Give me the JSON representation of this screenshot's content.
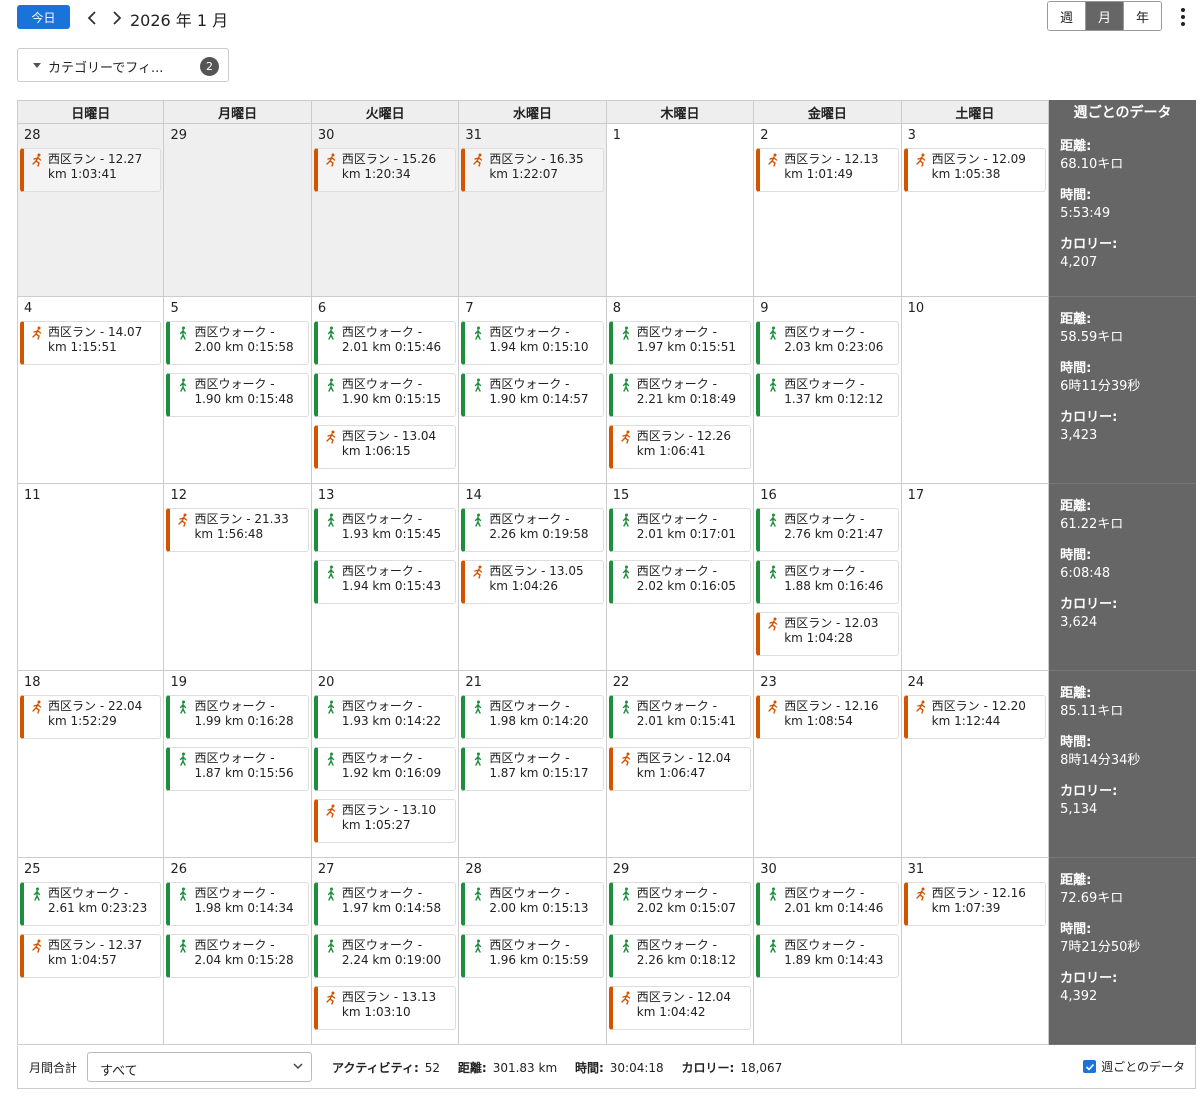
{
  "toolbar": {
    "today_label": "今日",
    "month_title": "2026 年 1 月",
    "views": [
      "週",
      "月",
      "年"
    ],
    "active_view": "月"
  },
  "filter": {
    "label": "カテゴリーでフィ...",
    "count": "2"
  },
  "weekdays": [
    "日曜日",
    "月曜日",
    "火曜日",
    "水曜日",
    "木曜日",
    "金曜日",
    "土曜日"
  ],
  "weekly_header": "週ごとのデータ",
  "weekly_labels": {
    "distance": "距離:",
    "time": "時間:",
    "calories": "カロリー:"
  },
  "colors": {
    "run": "#d35400",
    "walk": "#1e8e3e",
    "accent": "#1a73d9"
  },
  "weeks": [
    {
      "days": [
        {
          "num": "28",
          "other": true,
          "acts": [
            {
              "type": "run",
              "l1": "西区ラン - 12.27",
              "l2": "km 1:03:41"
            }
          ]
        },
        {
          "num": "29",
          "other": true,
          "acts": []
        },
        {
          "num": "30",
          "other": true,
          "acts": [
            {
              "type": "run",
              "l1": "西区ラン - 15.26",
              "l2": "km 1:20:34"
            }
          ]
        },
        {
          "num": "31",
          "other": true,
          "acts": [
            {
              "type": "run",
              "l1": "西区ラン - 16.35",
              "l2": "km 1:22:07"
            }
          ]
        },
        {
          "num": "1",
          "other": false,
          "acts": []
        },
        {
          "num": "2",
          "other": false,
          "acts": [
            {
              "type": "run",
              "l1": "西区ラン - 12.13",
              "l2": "km 1:01:49"
            }
          ]
        },
        {
          "num": "3",
          "other": false,
          "acts": [
            {
              "type": "run",
              "l1": "西区ラン - 12.09",
              "l2": "km 1:05:38"
            }
          ]
        }
      ],
      "summary": {
        "distance": "68.10キロ",
        "time": "5:53:49",
        "calories": "4,207"
      }
    },
    {
      "days": [
        {
          "num": "4",
          "other": false,
          "acts": [
            {
              "type": "run",
              "l1": "西区ラン - 14.07",
              "l2": "km 1:15:51"
            }
          ]
        },
        {
          "num": "5",
          "other": false,
          "acts": [
            {
              "type": "walk",
              "l1": "西区ウォーク -",
              "l2": "2.00 km 0:15:58"
            },
            {
              "type": "walk",
              "l1": "西区ウォーク -",
              "l2": "1.90 km 0:15:48"
            }
          ]
        },
        {
          "num": "6",
          "other": false,
          "acts": [
            {
              "type": "walk",
              "l1": "西区ウォーク -",
              "l2": "2.01 km 0:15:46"
            },
            {
              "type": "walk",
              "l1": "西区ウォーク -",
              "l2": "1.90 km 0:15:15"
            },
            {
              "type": "run",
              "l1": "西区ラン - 13.04",
              "l2": "km 1:06:15"
            }
          ]
        },
        {
          "num": "7",
          "other": false,
          "acts": [
            {
              "type": "walk",
              "l1": "西区ウォーク -",
              "l2": "1.94 km 0:15:10"
            },
            {
              "type": "walk",
              "l1": "西区ウォーク -",
              "l2": "1.90 km 0:14:57"
            }
          ]
        },
        {
          "num": "8",
          "other": false,
          "acts": [
            {
              "type": "walk",
              "l1": "西区ウォーク -",
              "l2": "1.97 km 0:15:51"
            },
            {
              "type": "walk",
              "l1": "西区ウォーク -",
              "l2": "2.21 km 0:18:49"
            },
            {
              "type": "run",
              "l1": "西区ラン - 12.26",
              "l2": "km 1:06:41"
            }
          ]
        },
        {
          "num": "9",
          "other": false,
          "acts": [
            {
              "type": "walk",
              "l1": "西区ウォーク -",
              "l2": "2.03 km 0:23:06"
            },
            {
              "type": "walk",
              "l1": "西区ウォーク -",
              "l2": "1.37 km 0:12:12"
            }
          ]
        },
        {
          "num": "10",
          "other": false,
          "acts": []
        }
      ],
      "summary": {
        "distance": "58.59キロ",
        "time": "6時11分39秒",
        "calories": "3,423"
      }
    },
    {
      "days": [
        {
          "num": "11",
          "other": false,
          "acts": []
        },
        {
          "num": "12",
          "other": false,
          "acts": [
            {
              "type": "run",
              "l1": "西区ラン - 21.33",
              "l2": "km 1:56:48"
            }
          ]
        },
        {
          "num": "13",
          "other": false,
          "acts": [
            {
              "type": "walk",
              "l1": "西区ウォーク -",
              "l2": "1.93 km 0:15:45"
            },
            {
              "type": "walk",
              "l1": "西区ウォーク -",
              "l2": "1.94 km 0:15:43"
            }
          ]
        },
        {
          "num": "14",
          "other": false,
          "acts": [
            {
              "type": "walk",
              "l1": "西区ウォーク -",
              "l2": "2.26 km 0:19:58"
            },
            {
              "type": "run",
              "l1": "西区ラン - 13.05",
              "l2": "km 1:04:26"
            }
          ]
        },
        {
          "num": "15",
          "other": false,
          "acts": [
            {
              "type": "walk",
              "l1": "西区ウォーク -",
              "l2": "2.01 km 0:17:01"
            },
            {
              "type": "walk",
              "l1": "西区ウォーク -",
              "l2": "2.02 km 0:16:05"
            }
          ]
        },
        {
          "num": "16",
          "other": false,
          "acts": [
            {
              "type": "walk",
              "l1": "西区ウォーク -",
              "l2": "2.76 km 0:21:47"
            },
            {
              "type": "walk",
              "l1": "西区ウォーク -",
              "l2": "1.88 km 0:16:46"
            },
            {
              "type": "run",
              "l1": "西区ラン - 12.03",
              "l2": "km 1:04:28"
            }
          ]
        },
        {
          "num": "17",
          "other": false,
          "acts": []
        }
      ],
      "summary": {
        "distance": "61.22キロ",
        "time": "6:08:48",
        "calories": "3,624"
      }
    },
    {
      "days": [
        {
          "num": "18",
          "other": false,
          "acts": [
            {
              "type": "run",
              "l1": "西区ラン - 22.04",
              "l2": "km 1:52:29"
            }
          ]
        },
        {
          "num": "19",
          "other": false,
          "acts": [
            {
              "type": "walk",
              "l1": "西区ウォーク -",
              "l2": "1.99 km 0:16:28"
            },
            {
              "type": "walk",
              "l1": "西区ウォーク -",
              "l2": "1.87 km 0:15:56"
            }
          ]
        },
        {
          "num": "20",
          "other": false,
          "acts": [
            {
              "type": "walk",
              "l1": "西区ウォーク -",
              "l2": "1.93 km 0:14:22"
            },
            {
              "type": "walk",
              "l1": "西区ウォーク -",
              "l2": "1.92 km 0:16:09"
            },
            {
              "type": "run",
              "l1": "西区ラン - 13.10",
              "l2": "km 1:05:27"
            }
          ]
        },
        {
          "num": "21",
          "other": false,
          "acts": [
            {
              "type": "walk",
              "l1": "西区ウォーク -",
              "l2": "1.98 km 0:14:20"
            },
            {
              "type": "walk",
              "l1": "西区ウォーク -",
              "l2": "1.87 km 0:15:17"
            }
          ]
        },
        {
          "num": "22",
          "other": false,
          "acts": [
            {
              "type": "walk",
              "l1": "西区ウォーク -",
              "l2": "2.01 km 0:15:41"
            },
            {
              "type": "run",
              "l1": "西区ラン - 12.04",
              "l2": "km 1:06:47"
            }
          ]
        },
        {
          "num": "23",
          "other": false,
          "acts": [
            {
              "type": "run",
              "l1": "西区ラン - 12.16",
              "l2": "km 1:08:54"
            }
          ]
        },
        {
          "num": "24",
          "other": false,
          "acts": [
            {
              "type": "run",
              "l1": "西区ラン - 12.20",
              "l2": "km 1:12:44"
            }
          ]
        }
      ],
      "summary": {
        "distance": "85.11キロ",
        "time": "8時14分34秒",
        "calories": "5,134"
      }
    },
    {
      "days": [
        {
          "num": "25",
          "other": false,
          "acts": [
            {
              "type": "walk",
              "l1": "西区ウォーク -",
              "l2": "2.61 km 0:23:23"
            },
            {
              "type": "run",
              "l1": "西区ラン - 12.37",
              "l2": "km 1:04:57"
            }
          ]
        },
        {
          "num": "26",
          "other": false,
          "acts": [
            {
              "type": "walk",
              "l1": "西区ウォーク -",
              "l2": "1.98 km 0:14:34"
            },
            {
              "type": "walk",
              "l1": "西区ウォーク -",
              "l2": "2.04 km 0:15:28"
            }
          ]
        },
        {
          "num": "27",
          "other": false,
          "acts": [
            {
              "type": "walk",
              "l1": "西区ウォーク -",
              "l2": "1.97 km 0:14:58"
            },
            {
              "type": "walk",
              "l1": "西区ウォーク -",
              "l2": "2.24 km 0:19:00"
            },
            {
              "type": "run",
              "l1": "西区ラン - 13.13",
              "l2": "km 1:03:10"
            }
          ]
        },
        {
          "num": "28",
          "other": false,
          "acts": [
            {
              "type": "walk",
              "l1": "西区ウォーク -",
              "l2": "2.00 km 0:15:13"
            },
            {
              "type": "walk",
              "l1": "西区ウォーク -",
              "l2": "1.96 km 0:15:59"
            }
          ]
        },
        {
          "num": "29",
          "other": false,
          "acts": [
            {
              "type": "walk",
              "l1": "西区ウォーク -",
              "l2": "2.02 km 0:15:07"
            },
            {
              "type": "walk",
              "l1": "西区ウォーク -",
              "l2": "2.26 km 0:18:12"
            },
            {
              "type": "run",
              "l1": "西区ラン - 12.04",
              "l2": "km 1:04:42"
            }
          ]
        },
        {
          "num": "30",
          "other": false,
          "acts": [
            {
              "type": "walk",
              "l1": "西区ウォーク -",
              "l2": "2.01 km 0:14:46"
            },
            {
              "type": "walk",
              "l1": "西区ウォーク -",
              "l2": "1.89 km 0:14:43"
            }
          ]
        },
        {
          "num": "31",
          "other": false,
          "acts": [
            {
              "type": "run",
              "l1": "西区ラン - 12.16",
              "l2": "km 1:07:39"
            }
          ]
        }
      ],
      "summary": {
        "distance": "72.69キロ",
        "time": "7時21分50秒",
        "calories": "4,392"
      }
    }
  ],
  "footer": {
    "total_label": "月間合計",
    "select_value": "すべて",
    "activities_label": "アクティビティ:",
    "activities_value": "52",
    "distance_label": "距離:",
    "distance_value": "301.83 km",
    "time_label": "時間:",
    "time_value": "30:04:18",
    "calories_label": "カロリー:",
    "calories_value": "18,067",
    "weekly_toggle_label": "週ごとのデータ",
    "weekly_toggle_checked": true
  }
}
